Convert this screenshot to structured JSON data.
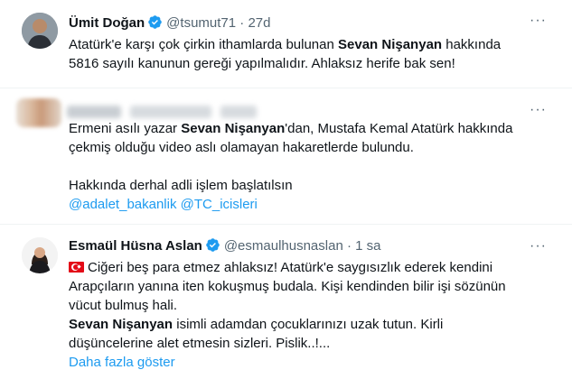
{
  "tweets": [
    {
      "name": "Ümit Doğan",
      "handle": "@tsumut71",
      "time": "27d",
      "more": "···",
      "text_parts": [
        "Atatürk'e karşı çok çirkin ithamlarda bulunan ",
        "Sevan Nişanyan",
        " hakkında",
        "5816 sayılı kanunun gereği yapılmalıdır. Ahlaksız herife bak sen!"
      ]
    },
    {
      "more": "···",
      "line1_a": "Ermeni asılı yazar ",
      "line1_b": "Sevan Nişanyan",
      "line1_c": "'dan, Mustafa Kemal Atatürk hakkında",
      "line2": "çekmiş olduğu video aslı  olamayan hakaretlerde bulundu.",
      "line3": "Hakkında derhal adli işlem başlatılsın",
      "mentions": "@adalet_bakanlik @TC_icisleri"
    },
    {
      "name": "Esmaül Hüsna Aslan",
      "handle": "@esmaulhusnaslan",
      "time": "1 sa",
      "more": "···",
      "line1": "Ciğeri beş para etmez ahlaksız! Atatürk'e saygısızlık ederek kendini",
      "line2": "Arapçıların yanına iten kokuşmuş budala. Kişi kendinden bilir işi sözünün",
      "line3": "vücut bulmuş hali.",
      "line4_b": "Sevan Nişanyan",
      "line4_c": " isimli adamdan çocuklarınızı uzak tutun. Kirli",
      "line5": "düşüncelerine alet etmesin sizleri. Pislik..!...",
      "show_more": "Daha fazla göster"
    }
  ],
  "colors": {
    "accent": "#1d9bf0",
    "muted": "#536471",
    "text": "#0f1419",
    "divider": "#eff3f4"
  },
  "icons": [
    "verified-badge-icon",
    "more-options-icon",
    "turkey-flag-icon"
  ]
}
